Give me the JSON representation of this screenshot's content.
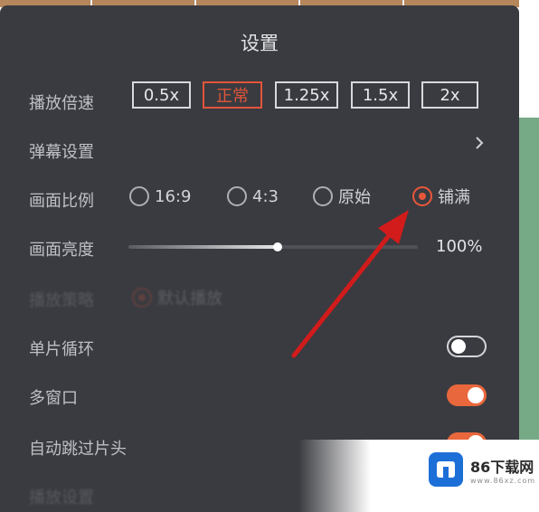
{
  "settings": {
    "title": "设置",
    "playback_speed": {
      "label": "播放倍速",
      "options": [
        "0.5x",
        "正常",
        "1.25x",
        "1.5x",
        "2x"
      ],
      "selected": "正常"
    },
    "danmaku": {
      "label": "弹幕设置"
    },
    "aspect_ratio": {
      "label": "画面比例",
      "options": [
        "16:9",
        "4:3",
        "原始",
        "铺满"
      ],
      "selected": "铺满"
    },
    "brightness": {
      "label": "画面亮度",
      "value_text": "100%",
      "level_fraction": 0.51
    },
    "blurred_row": {
      "label": "播放策略",
      "option": "默认播放"
    },
    "single_loop": {
      "label": "单片循环",
      "on": false
    },
    "multi_window": {
      "label": "多窗口",
      "on": true
    },
    "skip_intro": {
      "label": "自动跳过片头",
      "on": true
    },
    "partial_row": {
      "label": "播放设置"
    }
  },
  "colors": {
    "panel_bg": "#3a3b40",
    "accent": "#e9573a",
    "annotation_arrow": "#d21b1b"
  },
  "watermark": {
    "title": "86下载网",
    "subtitle": "www.86xz.com"
  }
}
